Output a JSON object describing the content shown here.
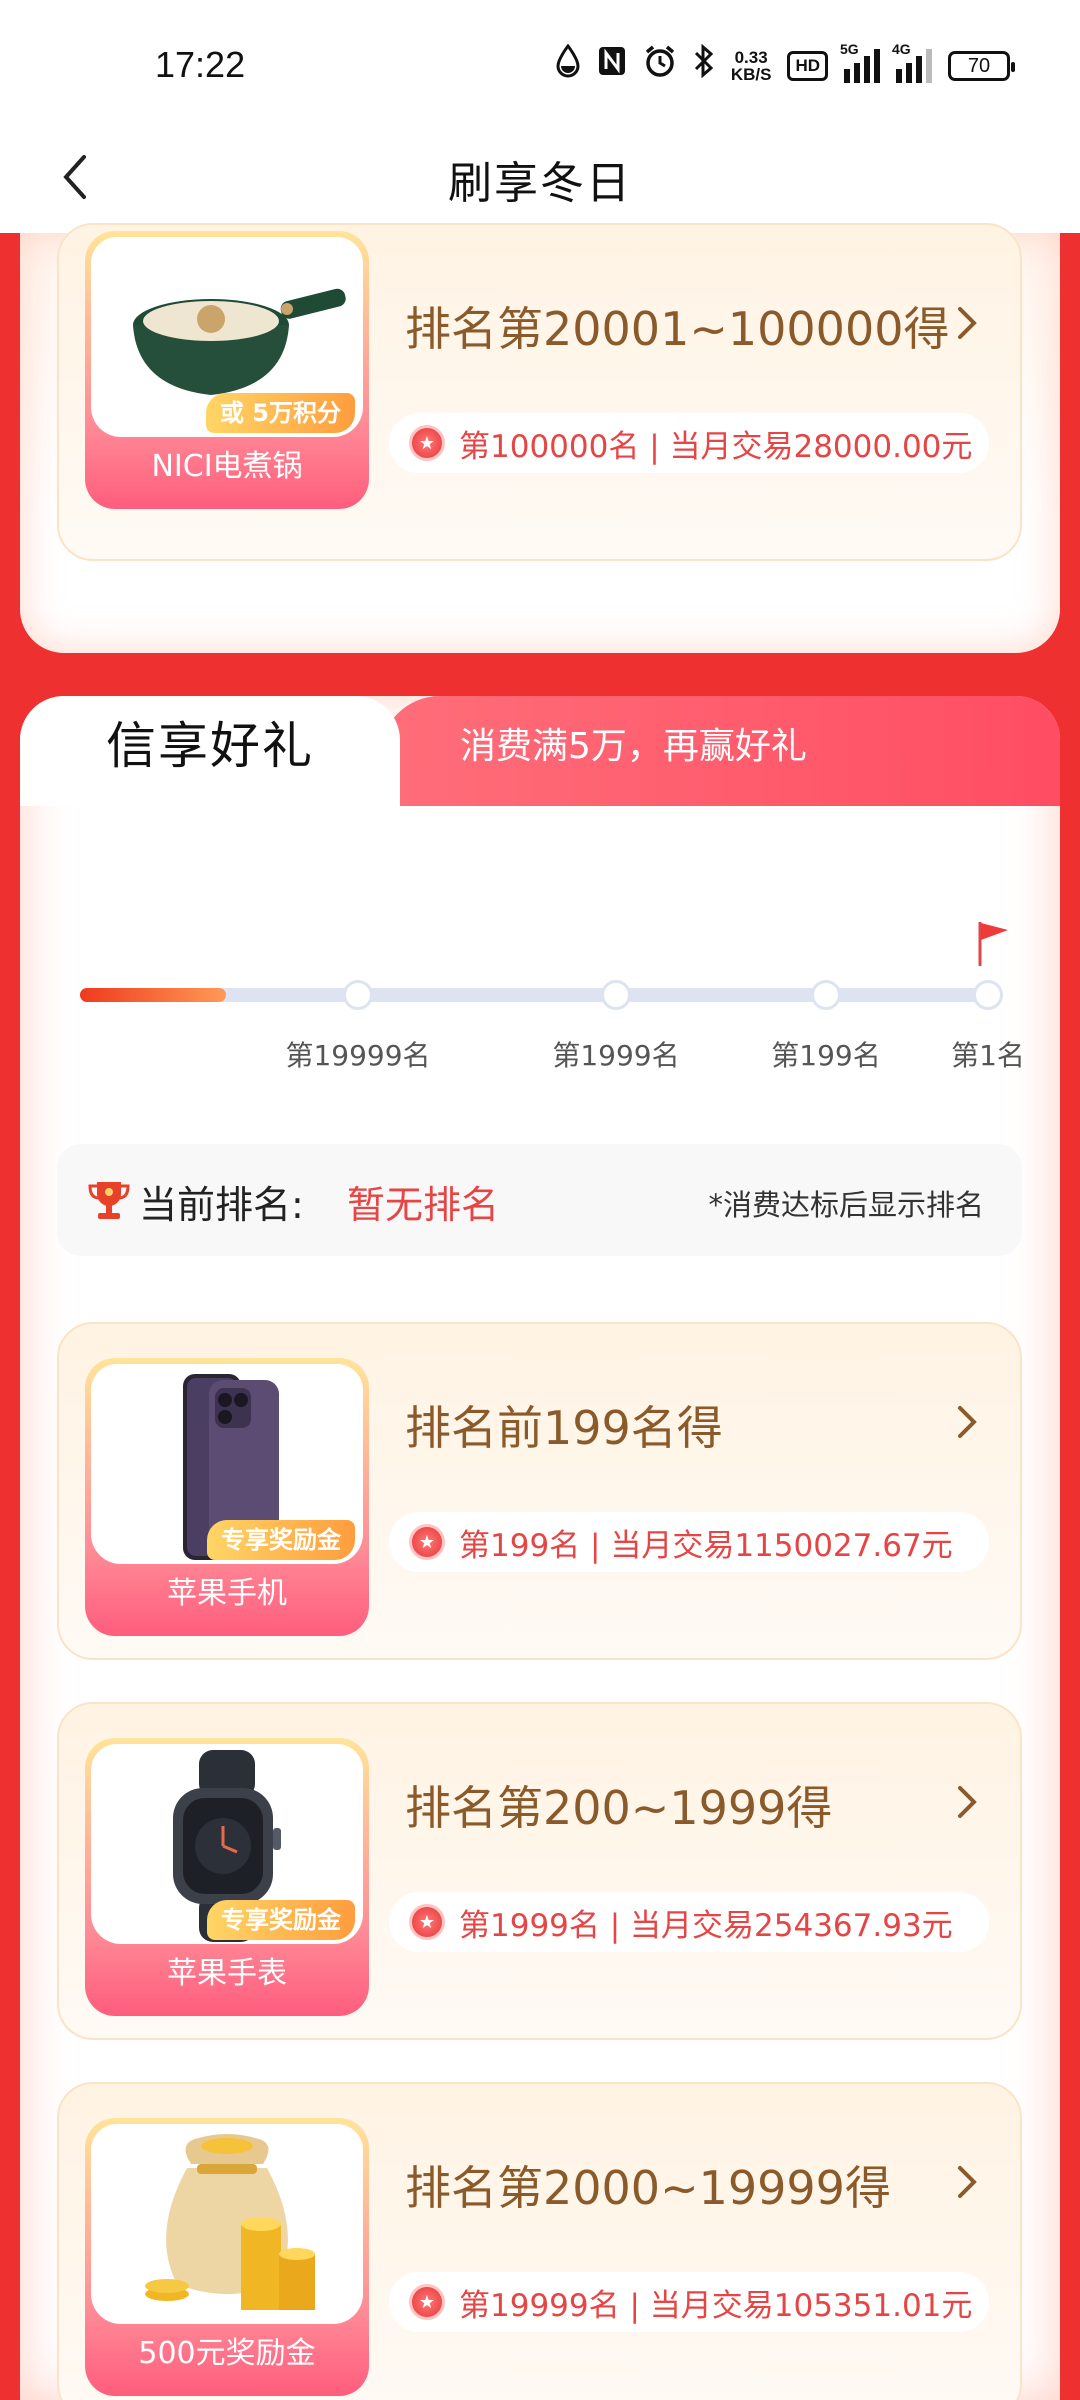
{
  "status_bar": {
    "time": "17:22",
    "speed_value": "0.33",
    "speed_unit": "KB/S",
    "hd": "HD",
    "signal1": "5G",
    "signal2": "4G",
    "battery": "70"
  },
  "header": {
    "title": "刷享冬日"
  },
  "top_card": {
    "prize": {
      "name": "NICI电煮锅",
      "badge": "或  5万积分",
      "title": "排名第20001~100000得",
      "detail": "第100000名 | 当月交易28000.00元"
    }
  },
  "section2": {
    "tab_active": "信享好礼",
    "tab_inactive": "消费满5万，再赢好礼",
    "progress": {
      "labels": [
        "第19999名",
        "第1999名",
        "第199名",
        "第1名"
      ],
      "fill_fraction": 0.1
    },
    "rank": {
      "label": "当前排名:",
      "value": "暂无排名",
      "hint": "*消费达标后显示排名"
    },
    "prizes": [
      {
        "name": "苹果手机",
        "badge": "专享奖励金",
        "title": "排名前199名得",
        "detail": "第199名 | 当月交易1150027.67元"
      },
      {
        "name": "苹果手表",
        "badge": "专享奖励金",
        "title": "排名第200~1999得",
        "detail": "第1999名 | 当月交易254367.93元"
      },
      {
        "name": "500元奖励金",
        "badge": "",
        "title": "排名第2000~19999得",
        "detail": "第19999名 | 当月交易105351.01元"
      }
    ]
  },
  "colors": {
    "page_bg": "#ef3030",
    "accent_red": "#e64545",
    "title_brown": "#8a5a2b"
  }
}
